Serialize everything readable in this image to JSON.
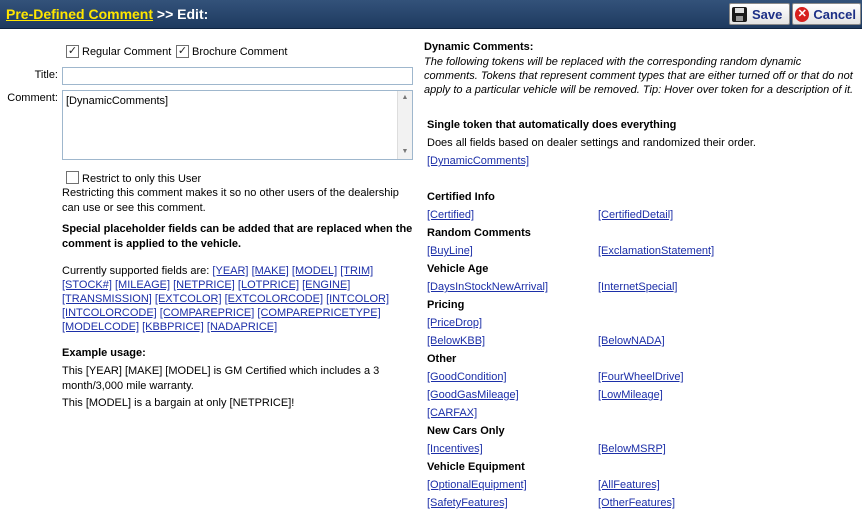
{
  "header": {
    "crumb": "Pre-Defined Comment",
    "sep": ">> Edit:",
    "save_label": "Save",
    "cancel_label": "Cancel"
  },
  "form": {
    "regular_comment_label": "Regular Comment",
    "regular_checked": true,
    "brochure_comment_label": "Brochure Comment",
    "brochure_checked": true,
    "title_label": "Title:",
    "title_value": "",
    "comment_label": "Comment:",
    "comment_value": "[DynamicComments]",
    "restrict_label": "Restrict to only this User",
    "restrict_checked": false,
    "restrict_note": "Restricting this comment makes it so no other users of the dealership can use or see this comment.",
    "placeholder_heading": "Special placeholder fields can be added that are replaced when the comment is applied to the vehicle.",
    "supported_prefix": "Currently supported fields are:",
    "supported_fields": [
      "[YEAR]",
      "[MAKE]",
      "[MODEL]",
      "[TRIM]",
      "[STOCK#]",
      "[MILEAGE]",
      "[NETPRICE]",
      "[LOTPRICE]",
      "[ENGINE]",
      "[TRANSMISSION]",
      "[EXTCOLOR]",
      "[EXTCOLORCODE]",
      "[INTCOLOR]",
      "[INTCOLORCODE]",
      "[COMPAREPRICE]",
      "[COMPAREPRICETYPE]",
      "[MODELCODE]",
      "[KBBPRICE]",
      "[NADAPRICE]"
    ],
    "example_heading": "Example usage:",
    "example_1": "This [YEAR] [MAKE] [MODEL] is GM Certified which includes a 3 month/3,000 mile warranty.",
    "example_2": "This [MODEL] is a bargain at only [NETPRICE]!"
  },
  "dynamic": {
    "heading": "Dynamic Comments:",
    "description": "The following tokens will be replaced with the corresponding random dynamic comments. Tokens that represent comment types that are either turned off or that do not apply to a particular vehicle will be removed. Tip: Hover over token for a description of it.",
    "single_heading": "Single token that automatically does everything",
    "single_desc": "Does all fields based on dealer settings and randomized their order.",
    "single_token": "[DynamicComments]",
    "certified_heading": "Certified Info",
    "certified_tokens": [
      "[Certified]",
      "[CertifiedDetail]"
    ],
    "random_heading": "Random Comments",
    "random_tokens": [
      "[BuyLine]",
      "[ExclamationStatement]"
    ],
    "age_heading": "Vehicle Age",
    "age_tokens": [
      "[DaysInStockNewArrival]",
      "[InternetSpecial]"
    ],
    "pricing_heading": "Pricing",
    "pricing_tokens": [
      "[PriceDrop]",
      "[BelowKBB]",
      "[BelowNADA]"
    ],
    "other_heading": "Other",
    "other_tokens": [
      "[GoodCondition]",
      "[FourWheelDrive]",
      "[GoodGasMileage]",
      "[LowMileage]",
      "[CARFAX]"
    ],
    "newcars_heading": "New Cars Only",
    "newcars_tokens": [
      "[Incentives]",
      "[BelowMSRP]"
    ],
    "equipment_heading": "Vehicle Equipment",
    "equipment_tokens": [
      "[OptionalEquipment]",
      "[AllFeatures]",
      "[SafetyFeatures]",
      "[OtherFeatures]"
    ]
  }
}
